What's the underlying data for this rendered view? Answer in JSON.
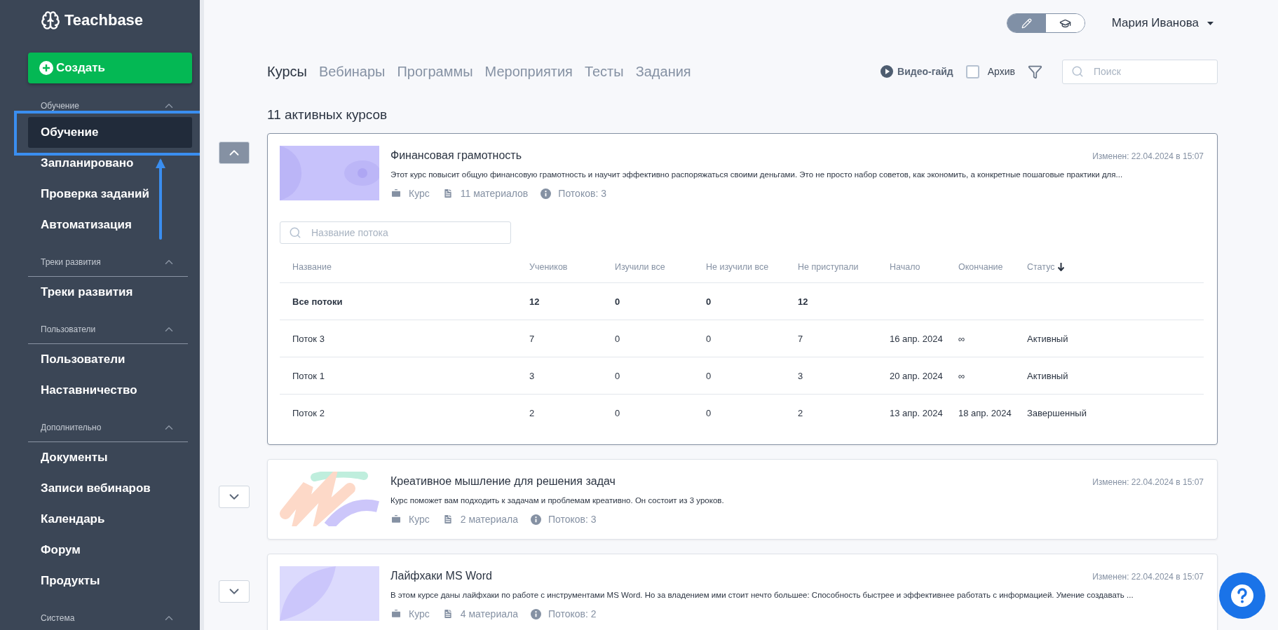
{
  "sidebar": {
    "logo": "Teachbase",
    "create_button": "Создать",
    "sections": [
      {
        "title": "Обучение",
        "expanded": true,
        "items": [
          {
            "label": "Обучение",
            "selected": true
          },
          {
            "label": "Запланировано",
            "selected": false
          },
          {
            "label": "Проверка заданий",
            "selected": false
          },
          {
            "label": "Автоматизация",
            "selected": false
          }
        ]
      },
      {
        "title": "Треки развития",
        "expanded": true,
        "items": [
          {
            "label": "Треки развития",
            "selected": false
          }
        ]
      },
      {
        "title": "Пользователи",
        "expanded": true,
        "items": [
          {
            "label": "Пользователи",
            "selected": false
          },
          {
            "label": "Наставничество",
            "selected": false
          }
        ]
      },
      {
        "title": "Дополнительно",
        "expanded": true,
        "items": [
          {
            "label": "Документы",
            "selected": false
          },
          {
            "label": "Записи вебинаров",
            "selected": false
          },
          {
            "label": "Календарь",
            "selected": false
          },
          {
            "label": "Форум",
            "selected": false
          },
          {
            "label": "Продукты",
            "selected": false
          }
        ]
      },
      {
        "title": "Система",
        "expanded": true
      }
    ]
  },
  "header": {
    "mode_toggle": [
      {
        "kind": "edit",
        "selected": true
      },
      {
        "kind": "learn",
        "selected": false
      }
    ],
    "user": "Мария Иванова"
  },
  "tabs": [
    {
      "label": "Курсы",
      "selected": true
    },
    {
      "label": "Вебинары",
      "selected": false
    },
    {
      "label": "Программы",
      "selected": false
    },
    {
      "label": "Мероприятия",
      "selected": false
    },
    {
      "label": "Тесты",
      "selected": false
    },
    {
      "label": "Задания",
      "selected": false
    }
  ],
  "toolbar": {
    "video_guide": "Видео-гайд",
    "archive": {
      "label": "Архив",
      "checked": false
    },
    "search": {
      "placeholder": "Поиск"
    }
  },
  "summary": "11 активных курсов",
  "courses": [
    {
      "title": "Финансовая грамотность",
      "description": "Этот курс повысит общую финансовую грамотность и научит эффективно распоряжаться своими деньгами. Это не просто набор советов, как экономить, а конкретные пошаговые практики для...",
      "modified": "Изменен: 22.04.2024 в 15:07",
      "type": "Курс",
      "materials": "11 материалов",
      "streams": "Потоков: 3",
      "expanded": true,
      "thumbnail": {
        "kind": "eye"
      },
      "stream_search": {
        "placeholder": "Название потока"
      },
      "table": {
        "columns": [
          {
            "label": "Название",
            "sorted": false
          },
          {
            "label": "Учеников",
            "sorted": false
          },
          {
            "label": "Изучили все",
            "sorted": false
          },
          {
            "label": "Не изучили все",
            "sorted": false
          },
          {
            "label": "Не приступали",
            "sorted": false
          },
          {
            "label": "Начало",
            "sorted": false
          },
          {
            "label": "Окончание",
            "sorted": false
          },
          {
            "label": "Статус",
            "sorted": true
          }
        ],
        "rows": [
          {
            "bold": true,
            "cells": [
              "Все потоки",
              "12",
              "0",
              "0",
              "12"
            ]
          },
          {
            "bold": false,
            "cells": [
              "Поток 3",
              "7",
              "0",
              "0",
              "7",
              "16 апр. 2024",
              "∞",
              "Активный"
            ]
          },
          {
            "bold": false,
            "cells": [
              "Поток 1",
              "3",
              "0",
              "0",
              "3",
              "20 апр. 2024",
              "∞",
              "Активный"
            ]
          },
          {
            "bold": false,
            "cells": [
              "Поток 2",
              "2",
              "0",
              "0",
              "2",
              "13 апр. 2024",
              "18 апр. 2024",
              "Завершенный"
            ]
          }
        ]
      }
    },
    {
      "title": "Креативное мышление для решения задач",
      "description": "Курс поможет вам подходить к задачам и проблемам креативно. Он состоит из 3 уроков.",
      "modified": "Изменен: 22.04.2024 в 15:07",
      "type": "Курс",
      "materials": "2 материала",
      "streams": "Потоков: 3",
      "expanded": false,
      "thumbnail": {
        "kind": "strokes"
      }
    },
    {
      "title": "Лайфхаки MS Word",
      "description": "В этом курсе даны лайфхаки по работе с инструментами MS Word. Но за владением ими стоит нечто большее: Способность быстрее и эффективнее работать с информацией. Умение создавать ...",
      "modified": "Изменен: 22.04.2024 в 15:07",
      "type": "Курс",
      "materials": "4 материала",
      "streams": "Потоков: 2",
      "expanded": false,
      "thumbnail": {
        "kind": "leaf"
      }
    }
  ]
}
